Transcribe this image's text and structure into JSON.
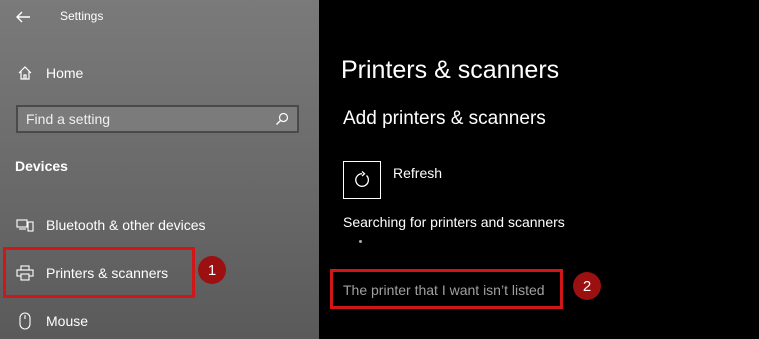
{
  "window": {
    "title": "Settings"
  },
  "sidebar": {
    "home_label": "Home",
    "search_placeholder": "Find a setting",
    "section_heading": "Devices",
    "items": [
      {
        "label": "Bluetooth & other devices",
        "icon": "bluetooth-devices-icon"
      },
      {
        "label": "Printers & scanners",
        "icon": "printer-icon"
      },
      {
        "label": "Mouse",
        "icon": "mouse-icon"
      }
    ]
  },
  "main": {
    "title": "Printers & scanners",
    "add_heading": "Add printers & scanners",
    "refresh_label": "Refresh",
    "searching_text": "Searching for printers and scanners",
    "not_listed_link": "The printer that I want isn’t listed"
  },
  "annotations": {
    "step1": "1",
    "step2": "2",
    "highlight_color": "#d01616",
    "badge_color": "#9b1010"
  }
}
